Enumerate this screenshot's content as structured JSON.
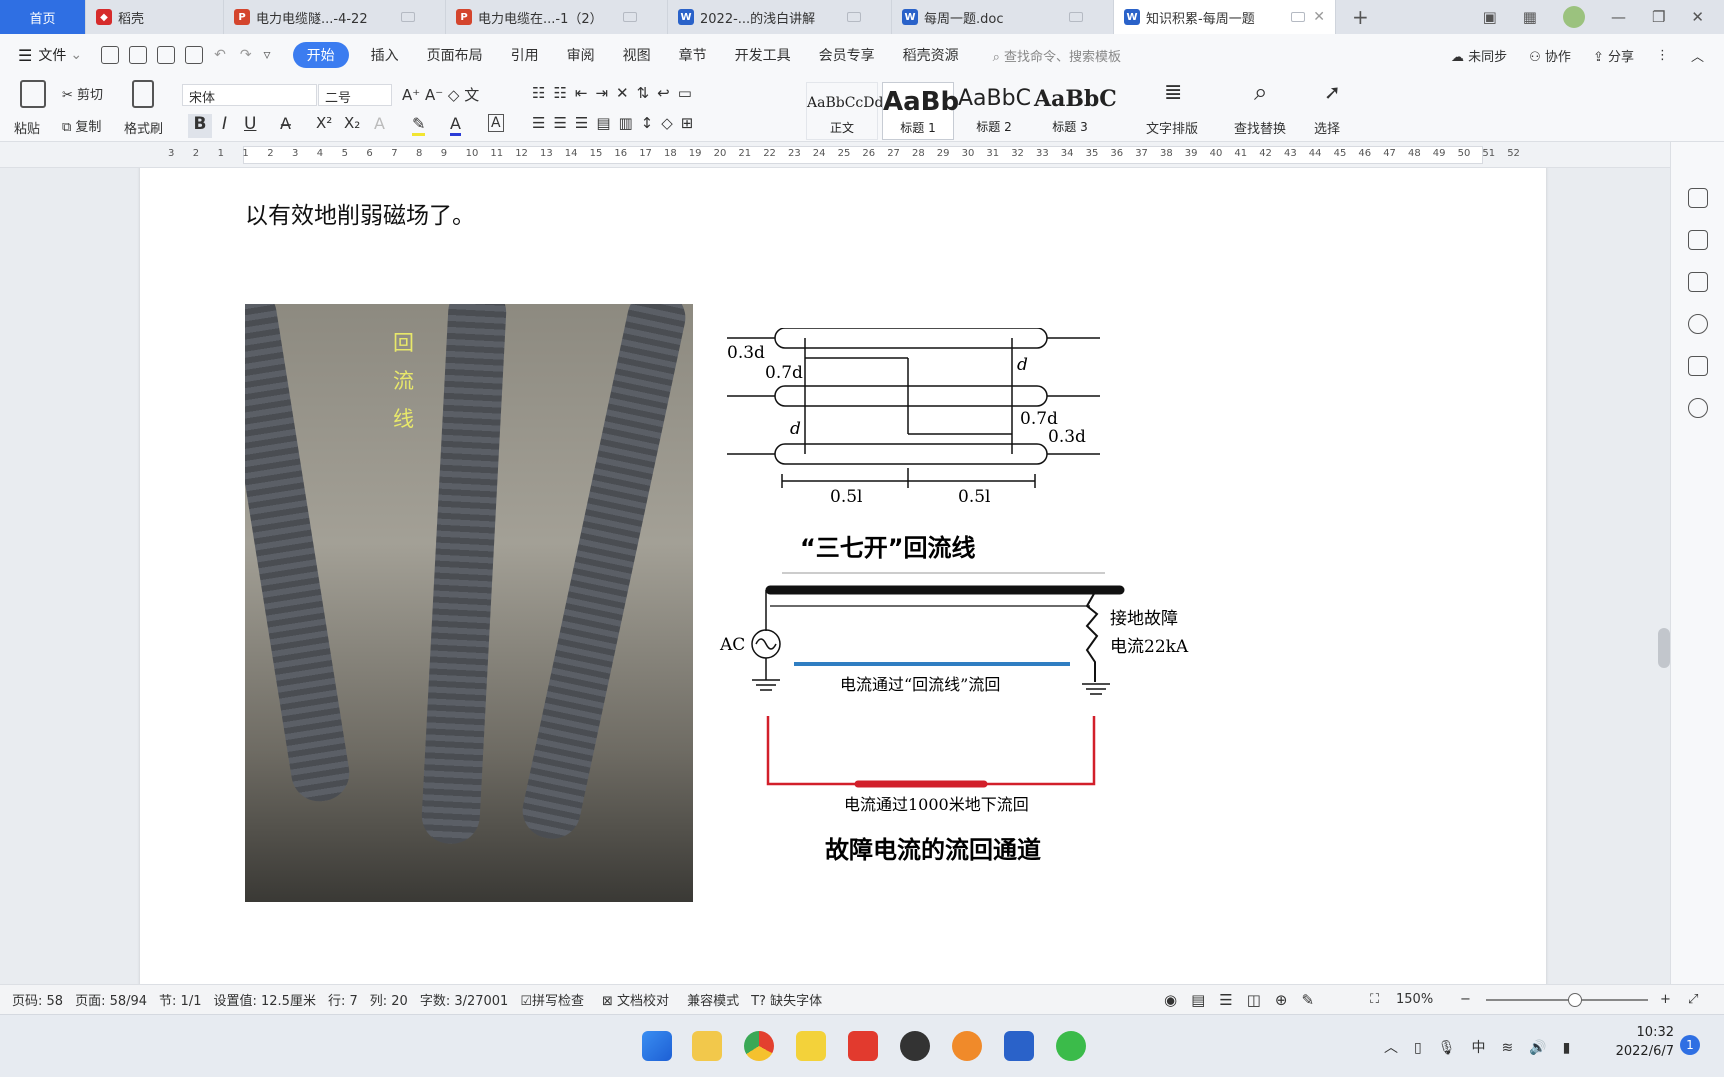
{
  "tabs": [
    {
      "label": "首页",
      "type": "home"
    },
    {
      "label": "稻壳",
      "icon": "daoke-icon",
      "color": "#d62b2b"
    },
    {
      "label": "电力电缆隧...-4-22",
      "icon": "ppt-icon",
      "color": "#d4452d"
    },
    {
      "label": "电力电缆在...-1（2）",
      "icon": "ppt-icon",
      "color": "#d4452d"
    },
    {
      "label": "2022-...的浅白讲解",
      "icon": "word-icon",
      "color": "#2a62c9"
    },
    {
      "label": "每周一题.doc",
      "icon": "word-icon",
      "color": "#2a62c9"
    },
    {
      "label": "知识积累-每周一题",
      "icon": "word-icon",
      "color": "#2a62c9",
      "active": true
    }
  ],
  "menu": {
    "file": "文件",
    "items": [
      "开始",
      "插入",
      "页面布局",
      "引用",
      "审阅",
      "视图",
      "章节",
      "开发工具",
      "会员专享",
      "稻壳资源"
    ],
    "search_placeholder": "查找命令、搜索模板",
    "right": [
      "未同步",
      "协作",
      "分享"
    ]
  },
  "ribbon": {
    "paste": "粘贴",
    "cut": "剪切",
    "copy": "复制",
    "format_painter": "格式刷",
    "font": "宋体",
    "size": "二号",
    "styles": [
      {
        "preview": "AaBbCcDd",
        "name": "正文"
      },
      {
        "preview": "AaBb",
        "name": "标题 1"
      },
      {
        "preview": "AaBbC",
        "name": "标题 2"
      },
      {
        "preview": "AaBbC",
        "name": "标题 3"
      }
    ],
    "text_layout": "文字排版",
    "find_replace": "查找替换",
    "select": "选择"
  },
  "ruler": [
    "3",
    "2",
    "1",
    "1",
    "2",
    "3",
    "4",
    "5",
    "6",
    "7",
    "8",
    "9",
    "10",
    "11",
    "12",
    "13",
    "14",
    "15",
    "16",
    "17",
    "18",
    "19",
    "20",
    "21",
    "22",
    "23",
    "24",
    "25",
    "26",
    "27",
    "28",
    "29",
    "30",
    "31",
    "32",
    "33",
    "34",
    "35",
    "36",
    "37",
    "38",
    "39",
    "40",
    "41",
    "42",
    "43",
    "44",
    "45",
    "46",
    "47",
    "48",
    "49",
    "50",
    "51",
    "52"
  ],
  "document": {
    "paragraph_end": "以有效地削弱磁场了。",
    "photo_label": [
      "回",
      "流",
      "线"
    ],
    "diagram1": {
      "labels": [
        "0.3d",
        "0.7d",
        "d",
        "d",
        "0.7d",
        "0.3d",
        "0.5l",
        "0.5l"
      ],
      "caption": "“三七开”回流线"
    },
    "diagram2": {
      "source": "AC",
      "fault": [
        "接地故障",
        "电流22kA"
      ],
      "path1": "电流通过“回流线”流回",
      "path2": "电流通过1000米地下流回",
      "caption": "故障电流的流回通道"
    }
  },
  "status": {
    "page_code": "页码: 58",
    "page": "页面: 58/94",
    "section": "节: 1/1",
    "setting": "设置值: 12.5厘米",
    "row": "行: 7",
    "col": "列: 20",
    "words": "字数: 3/27001",
    "spell": "拼写检查",
    "proof": "文档校对",
    "compat": "兼容模式",
    "missing_font": "缺失字体",
    "zoom": "150%"
  },
  "taskbar": {
    "time": "10:32",
    "date": "2022/6/7",
    "badge": "1"
  }
}
